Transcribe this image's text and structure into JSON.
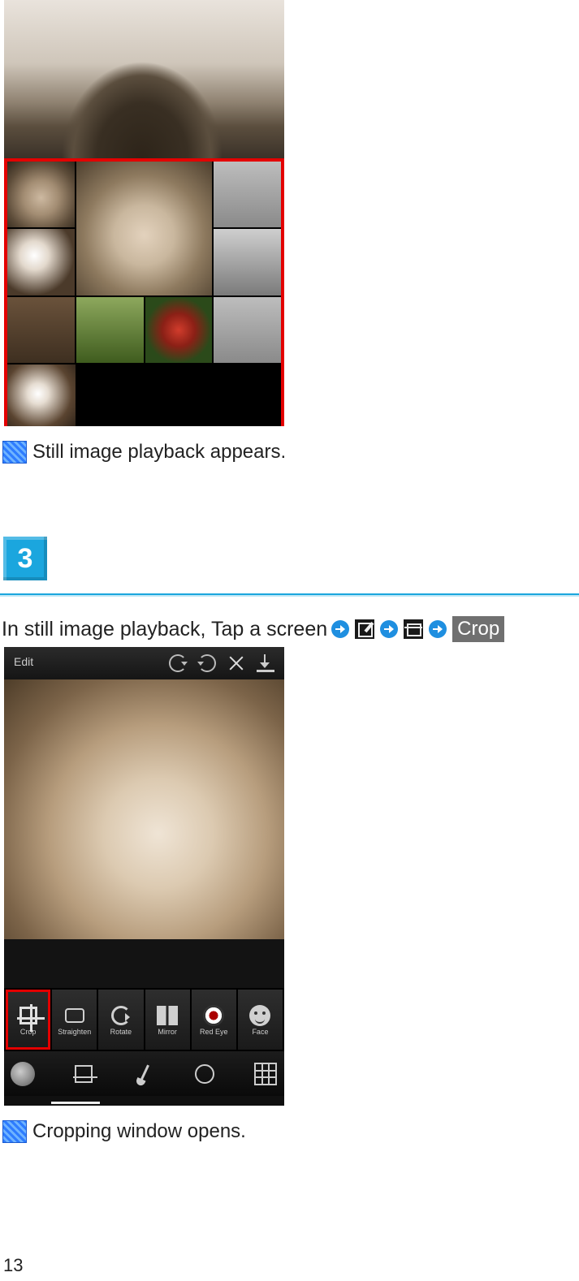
{
  "album": {
    "hero_caption": ""
  },
  "note1_text": "Still image playback appears.",
  "step_number": "3",
  "instruction_prefix": "In still image playback, Tap a screen",
  "crop_label": "Crop",
  "crop_topbar": {
    "title": "Edit"
  },
  "crop_tools": {
    "t0": "Crop",
    "t1": "Straighten",
    "t2": "Rotate",
    "t3": "Mirror",
    "t4": "Red Eye",
    "t5": "Face"
  },
  "note2_text": "Cropping window opens.",
  "page_number": "13"
}
